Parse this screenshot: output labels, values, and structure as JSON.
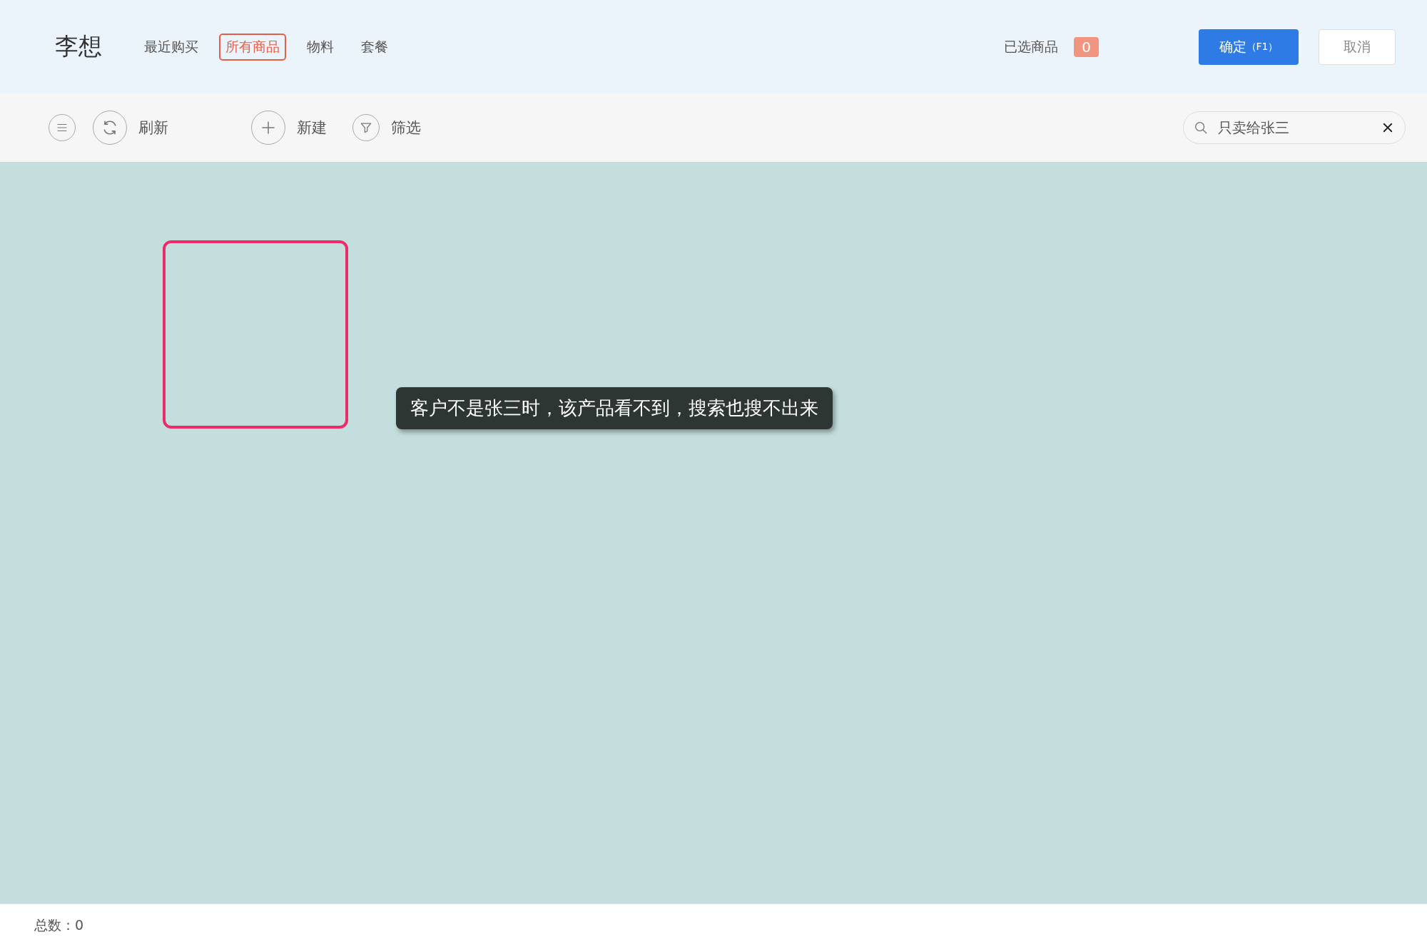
{
  "header": {
    "title": "李想",
    "tabs": [
      {
        "label": "最近购买",
        "selected": false
      },
      {
        "label": "所有商品",
        "selected": true
      },
      {
        "label": "物料",
        "selected": false
      },
      {
        "label": "套餐",
        "selected": false
      }
    ],
    "selected_goods": {
      "label": "已选商品",
      "count": "0"
    },
    "confirm_button": {
      "label": "确定",
      "shortcut": "（F1）"
    },
    "cancel_button": {
      "label": "取消"
    }
  },
  "toolbar": {
    "items": [
      {
        "kind": "menu"
      },
      {
        "kind": "refresh",
        "label": "刷新"
      },
      {
        "kind": "add",
        "label": "新建"
      },
      {
        "kind": "filter",
        "label": "筛选"
      }
    ],
    "search": {
      "value": "只卖给张三"
    }
  },
  "content": {
    "tooltip": "客户不是张三时，该产品看不到，搜索也搜不出来"
  },
  "footer": {
    "total_label": "总数：",
    "total": "0"
  }
}
